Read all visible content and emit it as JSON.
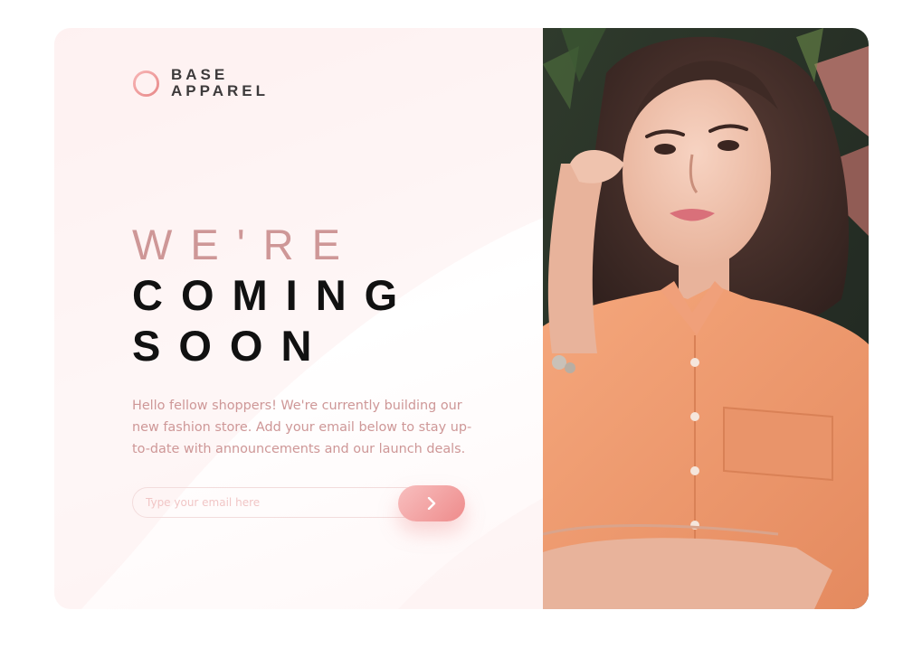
{
  "brand": {
    "name_line1": "BASE",
    "name_line2": "APPAREL"
  },
  "headline": {
    "line1": "WE'RE",
    "line2": "COMING",
    "line3": "SOON"
  },
  "intro": "Hello fellow shoppers! We're currently building our new fashion store. Add your email below to stay up-to-date with announcements and our launch deals.",
  "form": {
    "email_placeholder": "Type your email here",
    "submit_icon": "chevron-right-icon",
    "submit_aria": "Submit"
  },
  "hero": {
    "description": "Woman in a peach button-up shirt"
  },
  "colors": {
    "accent_soft": "#ce9797",
    "accent_gradient_start": "#f8bfbf",
    "accent_gradient_end": "#ee8b8b",
    "text_dark": "#111111",
    "logo_text": "#3d3a3b"
  }
}
